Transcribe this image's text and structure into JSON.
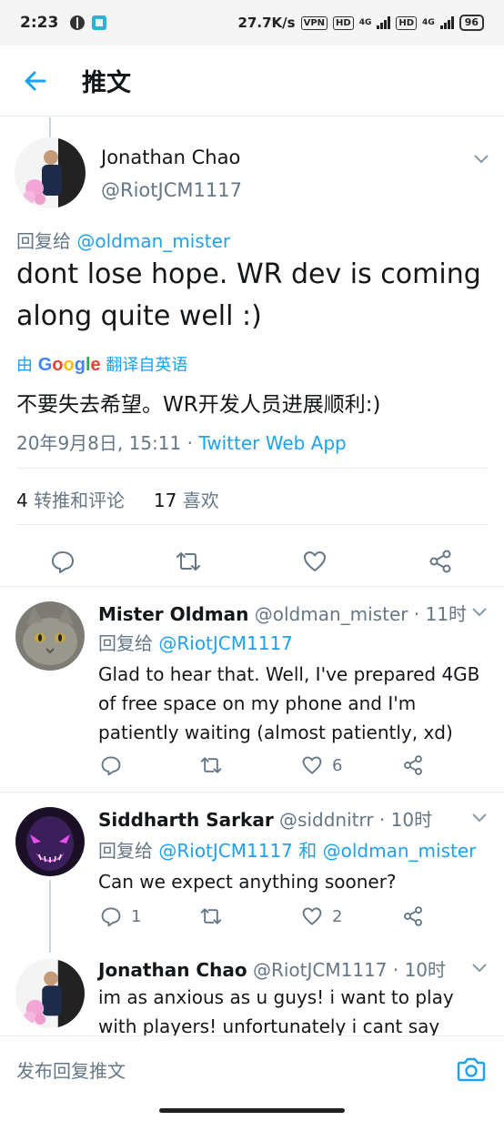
{
  "status_bar": {
    "time": "2:23",
    "speed": "27.7K/s",
    "vpn": "VPN",
    "hd1": "HD",
    "net1": "4G",
    "hd2": "HD",
    "net2": "4G",
    "battery": "96"
  },
  "header": {
    "title": "推文"
  },
  "main_tweet": {
    "name": "Jonathan Chao",
    "handle": "@RiotJCM1117",
    "reply_prefix": "回复给 ",
    "reply_mention": "@oldman_mister",
    "text": "dont lose hope. WR dev is coming along quite well :)",
    "translate_by": "由 ",
    "translate_brand": "Google",
    "translate_action": " 翻译自英语",
    "translated_text": "不要失去希望。WR开发人员进展顺利:)",
    "timestamp": "20年9月8日, 15:11",
    "dot": " · ",
    "app": "Twitter Web App",
    "retweets_count": "4",
    "retweets_label": " 转推和评论",
    "likes_count": "17",
    "likes_label": " 喜欢"
  },
  "replies": [
    {
      "name": "Mister Oldman",
      "handle": "@oldman_mister",
      "time": " · 11时",
      "reply_prefix": "回复给 ",
      "reply_mentions": "@RiotJCM1117",
      "text": "Glad to hear that.  Well, I've prepared 4GB of free space on my phone and I'm patiently waiting (almost patiently, xd)",
      "replies_count": "",
      "likes_count": "6"
    },
    {
      "name": "Siddharth Sarkar",
      "handle": "@siddnitrr",
      "time": " · 10时",
      "reply_prefix": "回复给 ",
      "reply_mentions": "@RiotJCM1117 和 @oldman_mister",
      "text": "Can we expect anything sooner?",
      "replies_count": "1",
      "likes_count": "2"
    },
    {
      "name": "Jonathan Chao",
      "handle": "@RiotJCM1117",
      "time": " · 10时",
      "text": "im as anxious as u guys! i want to play with players! unfortunately i cant say anything"
    }
  ],
  "compose": {
    "placeholder": "发布回复推文"
  },
  "colors": {
    "accent": "#1da1f2",
    "secondary_text": "#657786",
    "divider": "#e6ecf0"
  },
  "icons": [
    "back-arrow-icon",
    "chevron-down-icon",
    "reply-icon",
    "retweet-icon",
    "like-icon",
    "share-icon",
    "camera-icon"
  ]
}
